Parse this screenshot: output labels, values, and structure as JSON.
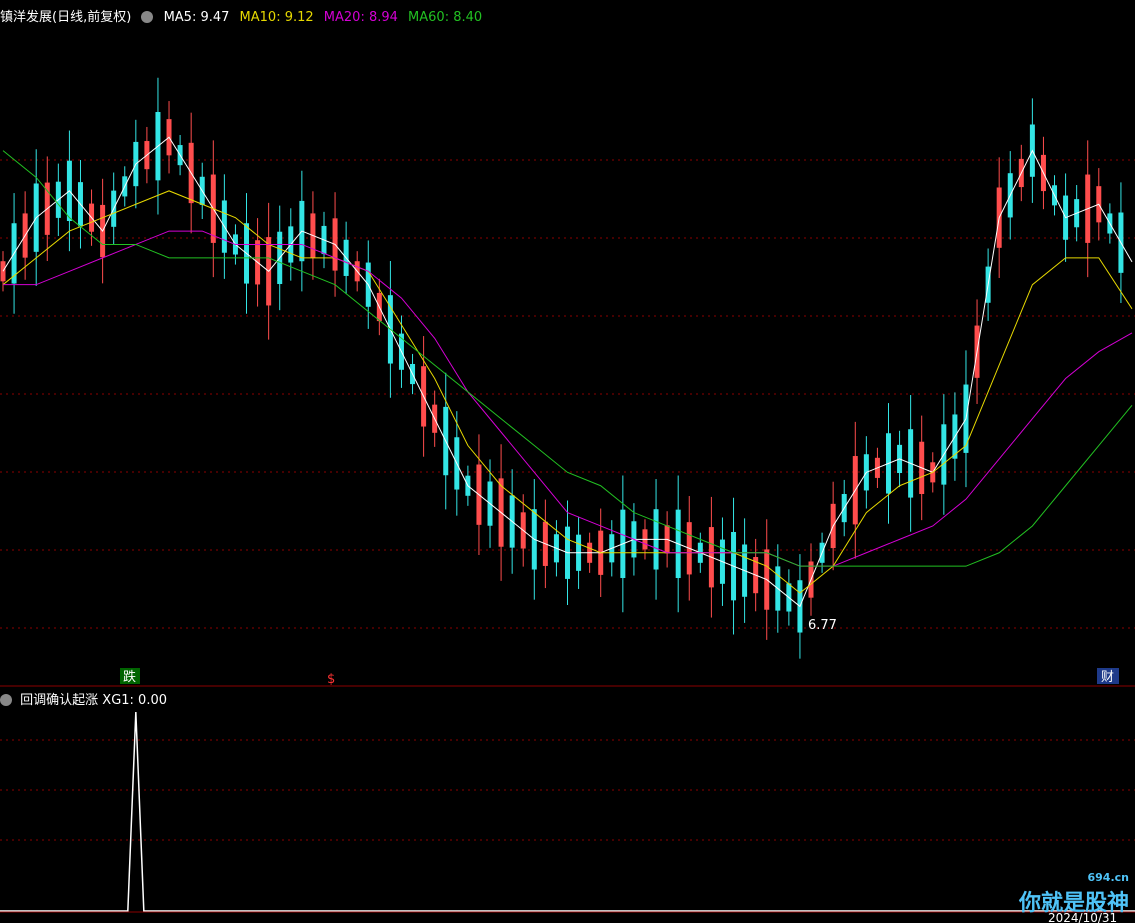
{
  "header": {
    "stock": "镇洋发展(日线,前复权)",
    "ma5": "MA5: 9.47",
    "ma10": "MA10: 9.12",
    "ma20": "MA20: 8.94",
    "ma60": "MA60: 8.40"
  },
  "colors": {
    "up": "#ff4d4d",
    "down": "#33e5e5",
    "ma5": "#ffffff",
    "ma10": "#e6d800",
    "ma20": "#d400d4",
    "ma60": "#22c022",
    "grid": "#8b0000"
  },
  "markers": {
    "fall": "跌",
    "s": "$",
    "cai": "财",
    "low": "6.77"
  },
  "indicator": {
    "name": "回调确认起涨",
    "value": "XG1: 0.00"
  },
  "xaxis": {
    "date": "2024/10/31"
  },
  "watermark": {
    "text": "你就是股神",
    "site": "694.cn"
  },
  "chart_data": {
    "type": "line",
    "title": "镇洋发展(日线,前复权)",
    "series": [
      {
        "name": "MA5",
        "last": 9.47,
        "values": [
          9.4,
          9.8,
          10.0,
          9.7,
          10.2,
          10.4,
          10.0,
          9.6,
          9.4,
          9.7,
          9.6,
          9.3,
          8.8,
          8.3,
          7.8,
          7.6,
          7.4,
          7.3,
          7.3,
          7.4,
          7.4,
          7.3,
          7.2,
          7.1,
          6.9,
          7.5,
          7.9,
          8.0,
          7.9,
          8.3,
          9.8,
          10.3,
          9.8,
          9.9,
          9.47
        ]
      },
      {
        "name": "MA10",
        "last": 9.12,
        "values": [
          9.3,
          9.5,
          9.7,
          9.8,
          9.9,
          10.0,
          9.9,
          9.8,
          9.6,
          9.5,
          9.5,
          9.4,
          9.0,
          8.6,
          8.1,
          7.8,
          7.6,
          7.4,
          7.3,
          7.3,
          7.3,
          7.3,
          7.3,
          7.2,
          7.0,
          7.2,
          7.6,
          7.8,
          7.9,
          8.1,
          8.7,
          9.3,
          9.5,
          9.5,
          9.12
        ]
      },
      {
        "name": "MA20",
        "last": 8.94,
        "values": [
          9.3,
          9.3,
          9.4,
          9.5,
          9.6,
          9.7,
          9.7,
          9.6,
          9.6,
          9.6,
          9.5,
          9.4,
          9.2,
          8.9,
          8.5,
          8.2,
          7.9,
          7.6,
          7.5,
          7.4,
          7.3,
          7.3,
          7.3,
          7.3,
          7.2,
          7.2,
          7.3,
          7.4,
          7.5,
          7.7,
          8.0,
          8.3,
          8.6,
          8.8,
          8.94
        ]
      },
      {
        "name": "MA60",
        "last": 8.4,
        "values": [
          10.3,
          10.1,
          9.8,
          9.6,
          9.6,
          9.5,
          9.5,
          9.5,
          9.5,
          9.4,
          9.3,
          9.1,
          8.9,
          8.7,
          8.5,
          8.3,
          8.1,
          7.9,
          7.8,
          7.6,
          7.5,
          7.4,
          7.3,
          7.3,
          7.2,
          7.2,
          7.2,
          7.2,
          7.2,
          7.2,
          7.3,
          7.5,
          7.8,
          8.1,
          8.4
        ]
      }
    ],
    "annotations": [
      "跌",
      "$",
      "财",
      "6.77"
    ],
    "sub_chart": {
      "name": "回调确认起涨",
      "series": "XG1",
      "last": 0.0,
      "spike_index": 4
    }
  }
}
